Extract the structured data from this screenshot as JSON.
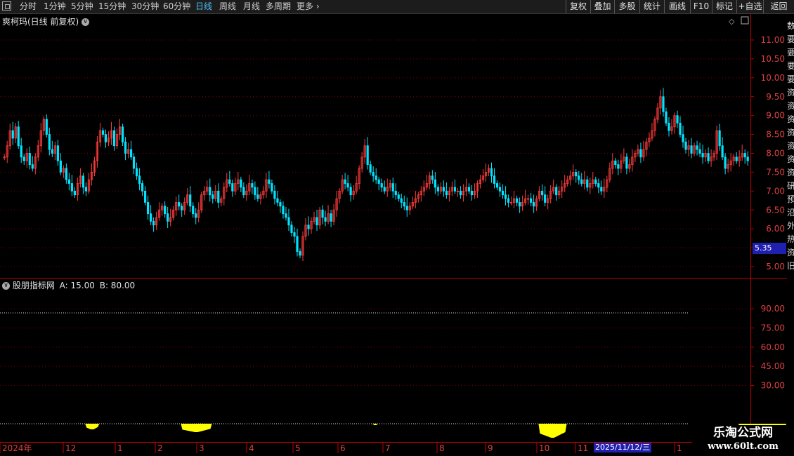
{
  "toolbar": {
    "periods": [
      "分时",
      "1分钟",
      "5分钟",
      "15分钟",
      "30分钟",
      "60分钟",
      "日线",
      "周线",
      "月线",
      "多周期",
      "更多"
    ],
    "active_period": "日线",
    "right_buttons": [
      "复权",
      "叠加",
      "多股",
      "统计",
      "画线",
      "F10",
      "标记",
      "+自选",
      "返回"
    ]
  },
  "chart": {
    "title": "爽柯玛(日线 前复权)",
    "price_tag": "5.35",
    "price_axis": [
      "11.00",
      "10.50",
      "10.00",
      "9.50",
      "9.00",
      "8.50",
      "8.00",
      "7.50",
      "7.00",
      "6.50",
      "6.00",
      "5.50",
      "5.00"
    ]
  },
  "indicator": {
    "title": "股朋指标网",
    "param_a": "A: 15.00",
    "param_b": "B: 80.00",
    "axis": [
      "90.00",
      "75.00",
      "60.00",
      "45.00",
      "30.00"
    ]
  },
  "time_axis": {
    "labels": [
      "2024年",
      "12",
      "1",
      "2",
      "3",
      "4",
      "5",
      "6",
      "7",
      "8",
      "9",
      "10",
      "11",
      "1"
    ],
    "selected_date": "2025/11/12/三"
  },
  "watermark": {
    "line1": "乐淘公式网",
    "line2": "www.60lt.com"
  },
  "right_strip": [
    "数",
    "要",
    "要",
    "要",
    "要",
    "资",
    "资",
    "资",
    "资",
    "资",
    "资",
    "资",
    "研",
    "预",
    "沿",
    "外",
    "热",
    "资",
    "旧"
  ],
  "colors": {
    "up": "#ff3c3c",
    "down": "#00e5ff",
    "grid": "#7a0000",
    "border": "#c00000",
    "signal": "#ffff00"
  },
  "chart_data": {
    "type": "candlestick",
    "note_series": "daily close, approximate",
    "ylim": [
      4.9,
      11.3
    ],
    "closes": [
      7.9,
      8.2,
      8.6,
      8.4,
      8.7,
      8.2,
      7.9,
      7.8,
      8.0,
      7.7,
      7.6,
      7.9,
      8.2,
      8.6,
      8.9,
      8.5,
      8.1,
      8.0,
      8.2,
      7.8,
      7.5,
      7.6,
      7.3,
      7.2,
      7.0,
      6.9,
      7.2,
      7.4,
      7.1,
      7.0,
      7.3,
      7.5,
      7.8,
      8.3,
      8.6,
      8.5,
      8.3,
      8.4,
      8.6,
      8.2,
      8.5,
      8.7,
      8.3,
      8.0,
      8.1,
      7.9,
      7.6,
      7.4,
      7.2,
      7.0,
      6.7,
      6.4,
      6.2,
      6.1,
      6.3,
      6.5,
      6.6,
      6.4,
      6.2,
      6.3,
      6.5,
      6.7,
      6.6,
      6.5,
      6.7,
      6.9,
      6.6,
      6.4,
      6.3,
      6.5,
      6.9,
      7.0,
      7.1,
      6.9,
      6.8,
      7.0,
      6.7,
      6.8,
      7.1,
      7.3,
      7.2,
      7.0,
      7.2,
      7.3,
      7.1,
      6.9,
      7.0,
      7.2,
      7.1,
      6.9,
      6.8,
      6.9,
      7.0,
      7.3,
      7.2,
      7.0,
      6.8,
      6.7,
      6.6,
      6.4,
      6.3,
      6.1,
      5.9,
      5.8,
      5.4,
      5.3,
      5.8,
      6.1,
      6.0,
      6.2,
      6.3,
      6.1,
      6.5,
      6.3,
      6.2,
      6.4,
      6.2,
      6.5,
      6.8,
      7.0,
      7.3,
      7.2,
      7.1,
      6.9,
      7.0,
      7.2,
      7.6,
      7.9,
      8.2,
      7.7,
      7.5,
      7.4,
      7.3,
      7.2,
      7.1,
      7.0,
      7.1,
      7.2,
      7.0,
      6.9,
      6.8,
      6.7,
      6.6,
      6.5,
      6.6,
      6.7,
      6.8,
      6.9,
      7.0,
      7.1,
      7.2,
      7.4,
      7.3,
      7.1,
      7.0,
      7.1,
      7.0,
      6.9,
      7.0,
      7.1,
      7.0,
      7.0,
      6.9,
      7.0,
      7.1,
      7.0,
      6.9,
      7.0,
      7.2,
      7.3,
      7.4,
      7.5,
      7.6,
      7.4,
      7.2,
      7.1,
      7.0,
      6.9,
      6.8,
      6.7,
      6.7,
      6.8,
      6.7,
      6.6,
      6.7,
      6.8,
      6.8,
      6.7,
      6.6,
      6.8,
      7.0,
      6.9,
      6.7,
      6.8,
      7.0,
      7.1,
      6.9,
      7.0,
      7.1,
      7.2,
      7.3,
      7.4,
      7.5,
      7.4,
      7.3,
      7.2,
      7.3,
      7.1,
      7.2,
      7.3,
      7.2,
      7.1,
      7.0,
      7.1,
      7.3,
      7.6,
      7.8,
      7.7,
      7.6,
      7.8,
      7.9,
      7.6,
      7.7,
      7.9,
      8.0,
      8.1,
      7.9,
      8.1,
      8.3,
      8.4,
      8.6,
      8.9,
      9.2,
      9.5,
      9.1,
      8.8,
      8.6,
      8.7,
      9.0,
      8.8,
      8.5,
      8.3,
      8.1,
      8.2,
      8.0,
      8.2,
      8.1,
      8.0,
      7.9,
      8.0,
      7.8,
      7.9,
      8.0,
      8.6,
      8.2,
      7.9,
      7.6,
      7.7,
      7.8,
      7.9,
      7.8,
      7.9,
      8.0,
      7.9,
      7.8
    ],
    "signal_blocks": [
      {
        "start": 29,
        "end": 34,
        "depth": 0.4
      },
      {
        "start": 63,
        "end": 74,
        "depth": 0.6
      },
      {
        "start": 131,
        "end": 133,
        "depth": 0.1
      },
      {
        "start": 190,
        "end": 200,
        "depth": 1.0
      },
      {
        "start": 261,
        "end": 278,
        "depth": 0.5
      }
    ],
    "indicator_ylim": [
      0,
      100
    ],
    "indicator_ref_lines": [
      80,
      15
    ]
  }
}
